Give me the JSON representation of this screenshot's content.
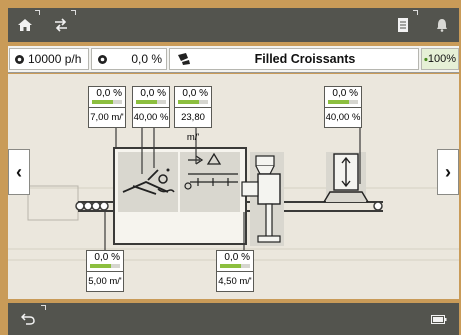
{
  "topbar": {
    "home_icon": "home-icon",
    "swap_icon": "swap-arrows-icon",
    "notes_icon": "notepad-icon",
    "bell_icon": "bell-icon"
  },
  "status": {
    "throughput": "10000 p/h",
    "speed_pct": "0,0 %",
    "product": "Filled Croissants",
    "efficiency": "100%"
  },
  "modules": [
    {
      "pct": "0,0 %",
      "value": "7,00 m/'"
    },
    {
      "pct": "0,0 %",
      "value": "40,00 %"
    },
    {
      "pct": "0,0 %",
      "value": "23,80 m/'"
    },
    {
      "pct": "0,0 %",
      "value": "40,00 %"
    },
    {
      "pct": "0,0 %",
      "value": "5,00 m/'"
    },
    {
      "pct": "0,0 %",
      "value": "4,50 m/'"
    }
  ],
  "nav": {
    "prev": "‹",
    "next": "›"
  },
  "colors": {
    "bar_dark": "#53544e",
    "background": "#c99b58",
    "accent_green": "#8cbf3f"
  }
}
